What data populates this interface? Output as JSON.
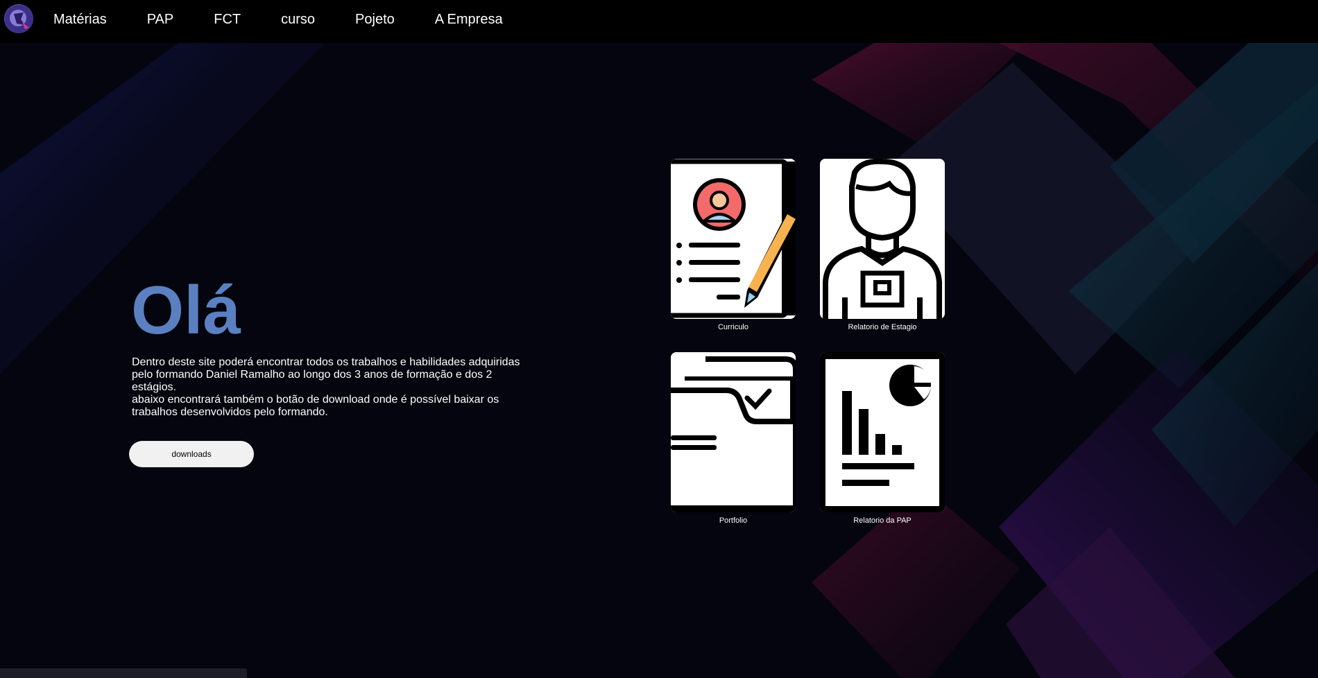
{
  "nav": {
    "items": [
      {
        "label": "Matérias"
      },
      {
        "label": "PAP"
      },
      {
        "label": "FCT"
      },
      {
        "label": "curso"
      },
      {
        "label": "Pojeto"
      },
      {
        "label": "A Empresa"
      }
    ]
  },
  "hero": {
    "title": "Olá",
    "paragraph_1": "Dentro deste site poderá encontrar todos os trabalhos e habilidades adquiridas pelo formando Daniel Ramalho ao longo dos 3 anos de formação e dos 2 estágios.",
    "paragraph_2": "abaixo encontrará também o botão de download onde é possível baixar os trabalhos desenvolvidos pelo formando.",
    "download_label": "downloads"
  },
  "cards": [
    {
      "label": "Curriculo",
      "icon": "resume-icon"
    },
    {
      "label": "Relatorio de Estagio",
      "icon": "employee-badge-icon"
    },
    {
      "label": "Portfolio",
      "icon": "folder-check-icon"
    },
    {
      "label": "Relatorio da PAP",
      "icon": "report-chart-icon"
    }
  ],
  "colors": {
    "accent": "#5b80c1",
    "navbar": "#000000",
    "background": "#04050e"
  }
}
